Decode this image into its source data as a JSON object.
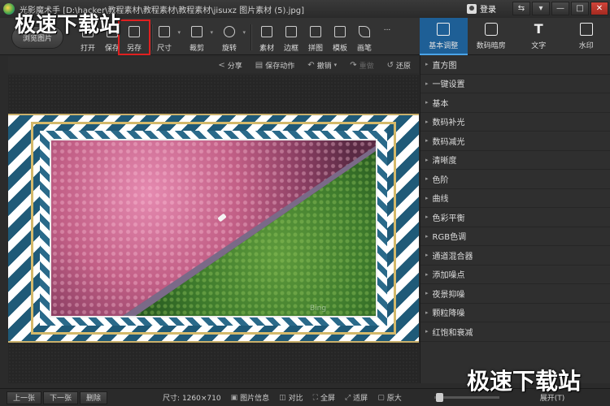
{
  "window": {
    "title": "光影魔术手 [D:\\hacker\\教程素材\\教程素材\\教程素材\\jisuxz 图片素材 (5).jpg]",
    "login_label": "登录",
    "buttons": [
      "⇆",
      "▾",
      "—",
      "□",
      "✕"
    ]
  },
  "toolbar": {
    "browse_label": "浏览图片",
    "tools": [
      {
        "label": "打开",
        "icon": "folder-icon"
      },
      {
        "label": "保存",
        "icon": "save-icon"
      },
      {
        "label": "另存",
        "icon": "save-as-icon"
      },
      {
        "label": "尺寸",
        "icon": "resize-icon"
      },
      {
        "label": "裁剪",
        "icon": "crop-icon"
      },
      {
        "label": "旋转",
        "icon": "rotate-icon"
      },
      {
        "label": "素材",
        "icon": "material-icon"
      },
      {
        "label": "边框",
        "icon": "border-icon"
      },
      {
        "label": "拼图",
        "icon": "collage-icon"
      },
      {
        "label": "模板",
        "icon": "template-icon"
      },
      {
        "label": "画笔",
        "icon": "brush-icon"
      },
      {
        "label": "...",
        "icon": "more-icon"
      }
    ],
    "right_tabs": [
      {
        "label": "基本调整",
        "icon": "adjust-icon"
      },
      {
        "label": "数码暗房",
        "icon": "camera-icon"
      },
      {
        "label": "文字",
        "icon": "text-icon"
      },
      {
        "label": "水印",
        "icon": "watermark-icon"
      }
    ]
  },
  "actions": {
    "share": "分享",
    "save_action": "保存动作",
    "undo": "撤销",
    "redo": "重做",
    "restore": "还原"
  },
  "photo": {
    "watermark": "Bing"
  },
  "panel": {
    "items": [
      "直方图",
      "一键设置",
      "基本",
      "数码补光",
      "数码减光",
      "清晰度",
      "色阶",
      "曲线",
      "色彩平衡",
      "RGB色调",
      "通道混合器",
      "添加噪点",
      "夜景抑噪",
      "颗粒降噪",
      "红饱和衰减"
    ]
  },
  "status": {
    "prev": "上一张",
    "next": "下一张",
    "delete": "删除",
    "size": "尺寸: 1260×710",
    "info": "图片信息",
    "compare": "对比",
    "fullscreen": "全屏",
    "fit": "适屏",
    "original": "原大",
    "expand": "展开(T)"
  },
  "site_mark": "极速下载站"
}
